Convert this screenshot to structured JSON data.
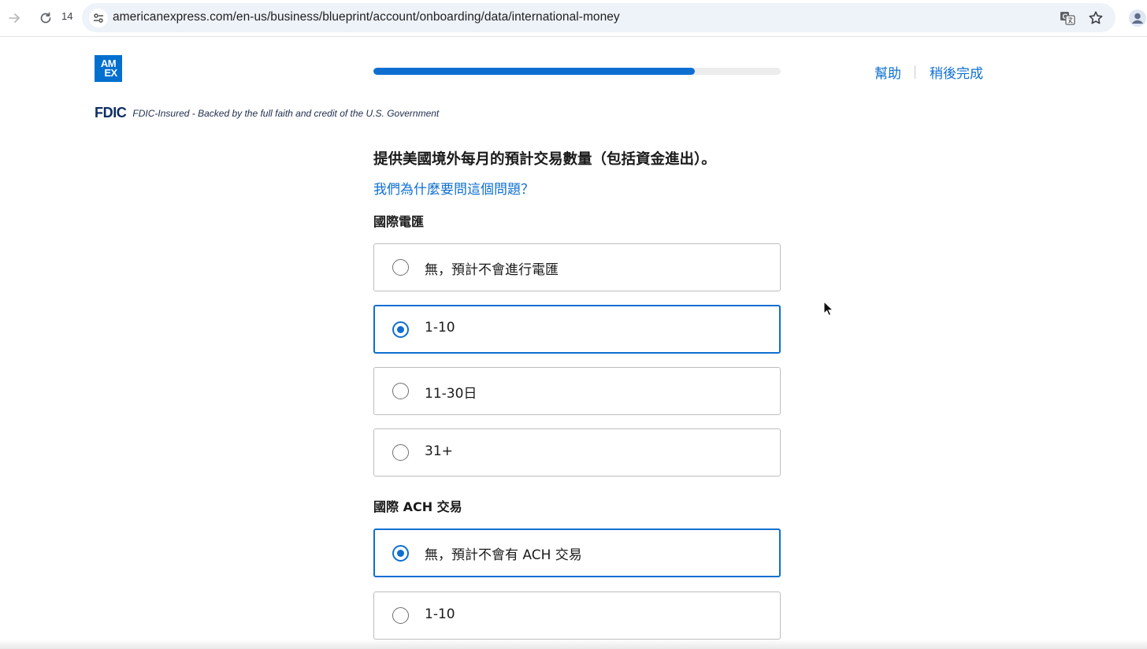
{
  "browser": {
    "tab_count": "14",
    "url": "americanexpress.com/en-us/business/blueprint/account/onboarding/data/international-money",
    "icons": [
      "forward-icon",
      "reload-icon",
      "site-info-icon",
      "translate-icon",
      "star-icon",
      "profile-icon"
    ]
  },
  "header": {
    "logo_line1": "AM",
    "logo_line2": "EX",
    "progress_percent": 79,
    "help_link": "幫助",
    "finish_later_link": "稍後完成",
    "brand_color": "#0e6fd1"
  },
  "fdic": {
    "logo": "FDIC",
    "text": "FDIC-Insured - Backed by the full faith and credit of the U.S. Government"
  },
  "form": {
    "title": "提供美國境外每月的預計交易數量（包括資金進出）。",
    "why_link": "我們為什麼要問這個問題？",
    "sections": [
      {
        "label": "國際電匯",
        "options": [
          {
            "label": "無，預計不會進行電匯",
            "selected": false
          },
          {
            "label": "1-10",
            "selected": true
          },
          {
            "label": "11-30日",
            "selected": false
          },
          {
            "label": "31+",
            "selected": false
          }
        ]
      },
      {
        "label": "國際 ACH 交易",
        "options": [
          {
            "label": "無，預計不會有 ACH 交易",
            "selected": true
          },
          {
            "label": "1-10",
            "selected": false
          }
        ]
      }
    ]
  }
}
